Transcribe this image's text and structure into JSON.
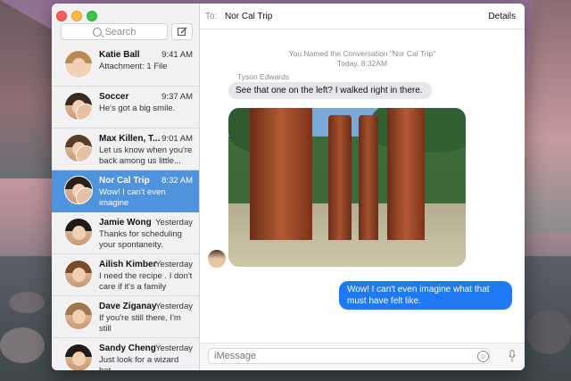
{
  "search": {
    "placeholder": "Search"
  },
  "conversations": [
    {
      "name": "Katie Ball",
      "time": "9:41 AM",
      "preview": "Attachment: 1 File",
      "selected": false
    },
    {
      "name": "Soccer",
      "time": "9:37 AM",
      "preview": "He's got a big smile.",
      "selected": false
    },
    {
      "name": "Max Killen, T...",
      "time": "9:01 AM",
      "preview": "Let us know when you're\nback among us little...",
      "selected": false
    },
    {
      "name": "Nor Cal Trip",
      "time": "8:32 AM",
      "preview": "Wow! I can't even imagine\nwhat that must have felt...",
      "selected": true
    },
    {
      "name": "Jamie Wong",
      "time": "Yesterday",
      "preview": "Thanks for scheduling\nyour spontaneity.",
      "selected": false
    },
    {
      "name": "Ailish Kimber",
      "time": "Yesterday",
      "preview": "I need the recipe . I don't\ncare if it's a family secret.",
      "selected": false
    },
    {
      "name": "Dave Ziganay",
      "time": "Yesterday",
      "preview": "If you're still there, I'm still\non my way.",
      "selected": false
    },
    {
      "name": "Sandy Cheng",
      "time": "Yesterday",
      "preview": "Just look for a wizard hat.\nThat'll be me",
      "selected": false
    }
  ],
  "header": {
    "to_label": "To:",
    "to_value": "Nor Cal Trip",
    "details_label": "Details"
  },
  "thread": {
    "system_line": "You Named the Conversation \"Nor Cal Trip\"",
    "system_time": "Today, 8:32AM",
    "sender": "Tyson Edwards",
    "incoming_text": "See that one on the left? I walked right in there.",
    "outgoing_text": "Wow! I can't even imagine what that must have felt like."
  },
  "composer": {
    "placeholder": "iMessage"
  },
  "colors": {
    "selected": "#4f93dc",
    "outgoing_bubble": "#1d7af3",
    "incoming_bubble": "#e5e5ea"
  }
}
